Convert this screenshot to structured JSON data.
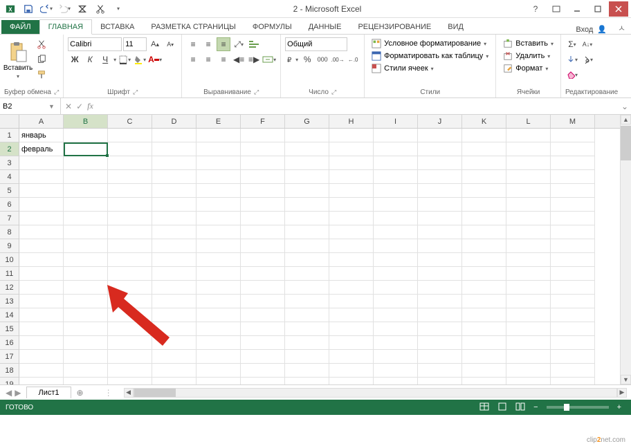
{
  "titlebar": {
    "title": "2 - Microsoft Excel"
  },
  "tabs": {
    "file": "ФАЙЛ",
    "items": [
      "ГЛАВНАЯ",
      "ВСТАВКА",
      "РАЗМЕТКА СТРАНИЦЫ",
      "ФОРМУЛЫ",
      "ДАННЫЕ",
      "РЕЦЕНЗИРОВАНИЕ",
      "ВИД"
    ],
    "active": 0,
    "signin": "Вход"
  },
  "ribbon": {
    "clipboard": {
      "paste": "Вставить",
      "label": "Буфер обмена"
    },
    "font": {
      "name": "Calibri",
      "size": "11",
      "label": "Шрифт",
      "bold": "Ж",
      "italic": "К",
      "underline": "Ч"
    },
    "alignment": {
      "label": "Выравнивание"
    },
    "number": {
      "format": "Общий",
      "label": "Число"
    },
    "styles": {
      "cond": "Условное форматирование",
      "table": "Форматировать как таблицу",
      "cell": "Стили ячеек",
      "label": "Стили"
    },
    "cells_group": {
      "insert": "Вставить",
      "delete": "Удалить",
      "format": "Формат",
      "label": "Ячейки"
    },
    "editing": {
      "label": "Редактирование"
    }
  },
  "namebox": {
    "value": "B2"
  },
  "formula": {
    "value": ""
  },
  "columns": [
    "A",
    "B",
    "C",
    "D",
    "E",
    "F",
    "G",
    "H",
    "I",
    "J",
    "K",
    "L",
    "M"
  ],
  "rows": [
    1,
    2,
    3,
    4,
    5,
    6,
    7,
    8,
    9,
    10,
    11,
    12,
    13,
    14,
    15,
    16,
    17,
    18,
    19
  ],
  "cells": {
    "A1": "январь",
    "A2": "февраль"
  },
  "selected": {
    "col": "B",
    "row": 2
  },
  "sheet": {
    "name": "Лист1"
  },
  "status": {
    "ready": "ГОТОВО"
  },
  "watermark": {
    "pre": "clip",
    "mid": "2",
    "post": "net.com"
  }
}
